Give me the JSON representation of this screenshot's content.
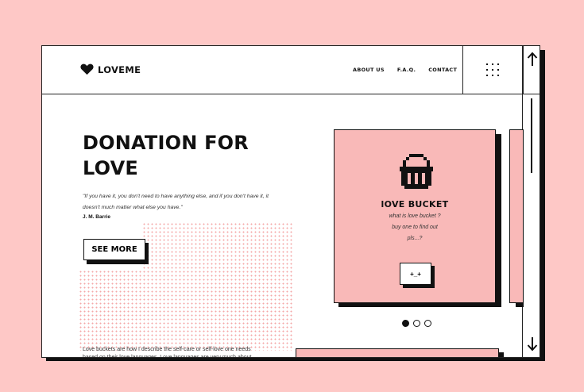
{
  "brand": {
    "name": "LOVEME",
    "icon": "heart-icon"
  },
  "nav": {
    "items": [
      {
        "label": "ABOUT US"
      },
      {
        "label": "F.A.Q."
      },
      {
        "label": "CONTACT"
      }
    ]
  },
  "menu": {
    "icon": "grid-menu-icon"
  },
  "scroll": {
    "up_icon": "arrow-up-icon",
    "down_icon": "arrow-down-icon"
  },
  "hero": {
    "title_line1": "DONATION FOR",
    "title_line2": "LOVE",
    "quote": "\"If you have it, you don't need to have anything else, and if you don't have it, it doesn't much matter what else you have.\"",
    "author": "J. M. Barrie",
    "cta": "SEE MORE",
    "paragraph": "Love buckets are how I describe the self-care or self-love one needs based on their love languages. Love languages are very much about"
  },
  "card": {
    "icon": "basket-icon",
    "title": "lOVE BUCKET",
    "line1": "what is love bucket ?",
    "line2": "buy one to find out",
    "line3": "pls...?",
    "button_label": "+_+"
  },
  "pager": {
    "count": 3,
    "active": 0
  },
  "colors": {
    "background": "#fec8c6",
    "card": "#f9b9b8",
    "ink": "#111111",
    "dots": "#f4a8a8"
  }
}
